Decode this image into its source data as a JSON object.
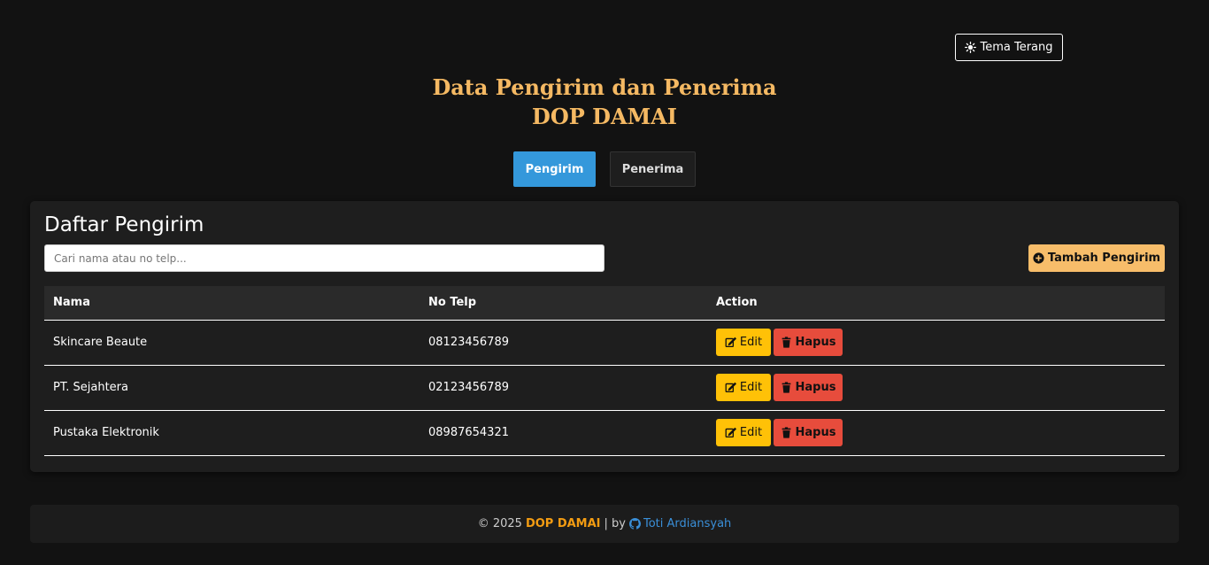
{
  "header": {
    "theme_toggle_label": "Tema Terang",
    "title_line1": "Data Pengirim dan Penerima",
    "title_line2": "DOP DAMAI"
  },
  "tabs": [
    {
      "label": "Pengirim",
      "active": true
    },
    {
      "label": "Penerima",
      "active": false
    }
  ],
  "card": {
    "title": "Daftar Pengirim",
    "search_placeholder": "Cari nama atau no telp...",
    "add_button_label": "Tambah Pengirim"
  },
  "table": {
    "headers": [
      "Nama",
      "No Telp",
      "Action"
    ],
    "rows": [
      {
        "nama": "Skincare Beaute",
        "telp": "08123456789"
      },
      {
        "nama": "PT. Sejahtera",
        "telp": "02123456789"
      },
      {
        "nama": "Pustaka Elektronik",
        "telp": "08987654321"
      }
    ],
    "edit_label": "Edit",
    "delete_label": "Hapus"
  },
  "footer": {
    "copyright": "© 2025",
    "brand": "DOP DAMAI",
    "separator": "| by",
    "author": "Toti Ardiansyah"
  },
  "colors": {
    "background": "#121212",
    "title": "#f5b963",
    "tab_active": "#3498db",
    "add_button": "#f7bd6a",
    "edit_button": "#ffc107",
    "delete_button": "#e74c3c",
    "footer_brand": "#f39c12",
    "footer_author": "#3a8fd8"
  },
  "icons": {
    "theme_toggle": "sun-icon",
    "add_button": "plus-circle-icon",
    "edit_button": "edit-icon",
    "delete_button": "trash-icon",
    "footer_author": "github-icon"
  }
}
